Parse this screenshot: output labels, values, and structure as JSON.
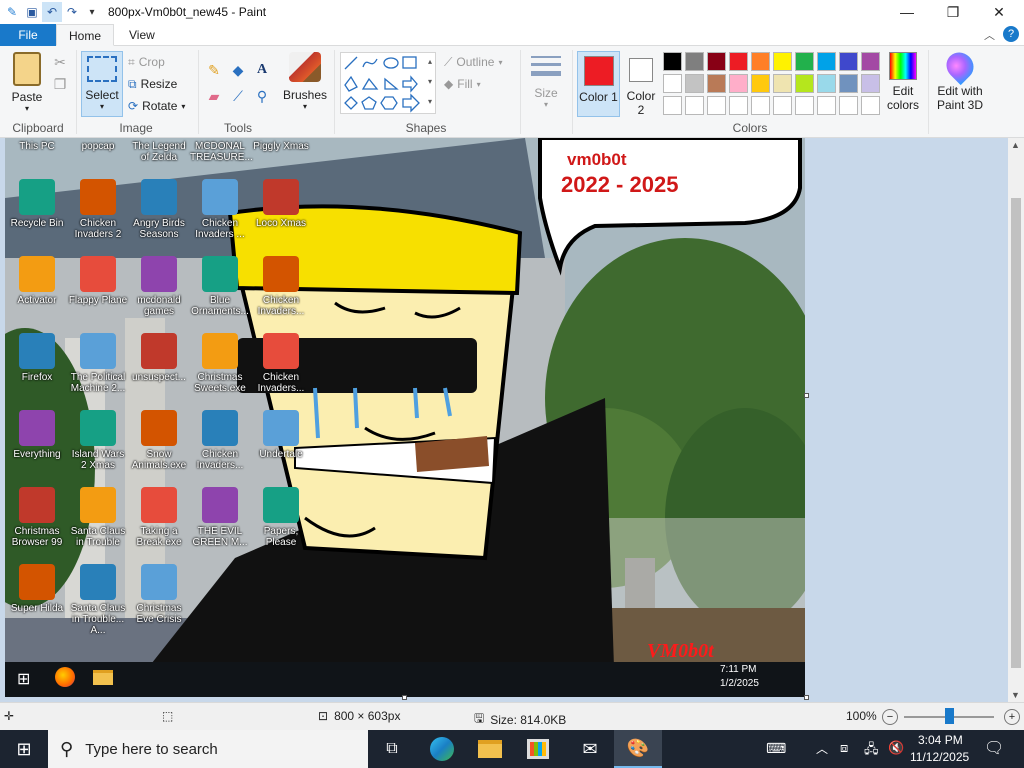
{
  "window": {
    "title": "800px-Vm0b0t_new45 - Paint"
  },
  "tabs": {
    "file": "File",
    "home": "Home",
    "view": "View"
  },
  "ribbon": {
    "clipboard": {
      "label": "Clipboard",
      "paste": "Paste"
    },
    "image": {
      "label": "Image",
      "select": "Select",
      "crop": "Crop",
      "resize": "Resize",
      "rotate": "Rotate"
    },
    "tools": {
      "label": "Tools"
    },
    "brushes": "Brushes",
    "shapes": {
      "label": "Shapes",
      "outline": "Outline",
      "fill": "Fill"
    },
    "size": "Size",
    "color1": "Color 1",
    "color2": "Color 2",
    "colors_label": "Colors",
    "edit_colors": "Edit colors",
    "edit_3d": "Edit with Paint 3D",
    "palette_row1": [
      "#000000",
      "#7f7f7f",
      "#880015",
      "#ed1c24",
      "#ff7f27",
      "#fff200",
      "#22b14c",
      "#00a2e8",
      "#3f48cc",
      "#a349a4"
    ],
    "palette_row2": [
      "#ffffff",
      "#c3c3c3",
      "#b97a57",
      "#ffaec9",
      "#ffc90e",
      "#efe4b0",
      "#b5e61d",
      "#99d9ea",
      "#7092be",
      "#c8bfe7"
    ],
    "color1_value": "#ed1c24",
    "color2_value": "#ffffff"
  },
  "canvas_image": {
    "speech_line1": "vm0b0t",
    "speech_line2": "2022 - 2025",
    "watermark": "VM0b0t",
    "inner_clock_time": "7:11 PM",
    "inner_clock_date": "1/2/2025",
    "desktop_icons": [
      {
        "label": "This PC"
      },
      {
        "label": "popcap"
      },
      {
        "label": "The Legend of Zelda"
      },
      {
        "label": "MCDONAL TREASURE..."
      },
      {
        "label": "Piggly Xmas"
      },
      {
        "label": "Recycle Bin"
      },
      {
        "label": "Chicken Invaders 2"
      },
      {
        "label": "Angry Birds Seasons"
      },
      {
        "label": "Chicken Invaders ..."
      },
      {
        "label": "Loco Xmas"
      },
      {
        "label": "Activator"
      },
      {
        "label": "Flappy Plane"
      },
      {
        "label": "mcdonald games"
      },
      {
        "label": "Blue Ornaments..."
      },
      {
        "label": "Chicken Invaders..."
      },
      {
        "label": "Firefox"
      },
      {
        "label": "The Political Machine 2..."
      },
      {
        "label": "unsuspect..."
      },
      {
        "label": "Christmas Sweets.exe"
      },
      {
        "label": "Chicken Invaders..."
      },
      {
        "label": "Everything"
      },
      {
        "label": "Island Wars 2 Xmas"
      },
      {
        "label": "Snow Animals.exe"
      },
      {
        "label": "Chicken Invaders..."
      },
      {
        "label": "Undertale"
      },
      {
        "label": "Christmas Browser 99"
      },
      {
        "label": "Santa Claus in Trouble"
      },
      {
        "label": "Taking a Break.exe"
      },
      {
        "label": "THE EVIL GREEN M..."
      },
      {
        "label": "Papers, Please"
      },
      {
        "label": "Super Hilda"
      },
      {
        "label": "Santa Claus in Trouble... A..."
      },
      {
        "label": "Christmas Eve Crisis"
      }
    ]
  },
  "status": {
    "dimensions": "800 × 603px",
    "size": "Size: 814.0KB",
    "zoom": "100%"
  },
  "taskbar": {
    "search_placeholder": "Type here to search",
    "time": "3:04 PM",
    "date": "11/12/2025"
  }
}
